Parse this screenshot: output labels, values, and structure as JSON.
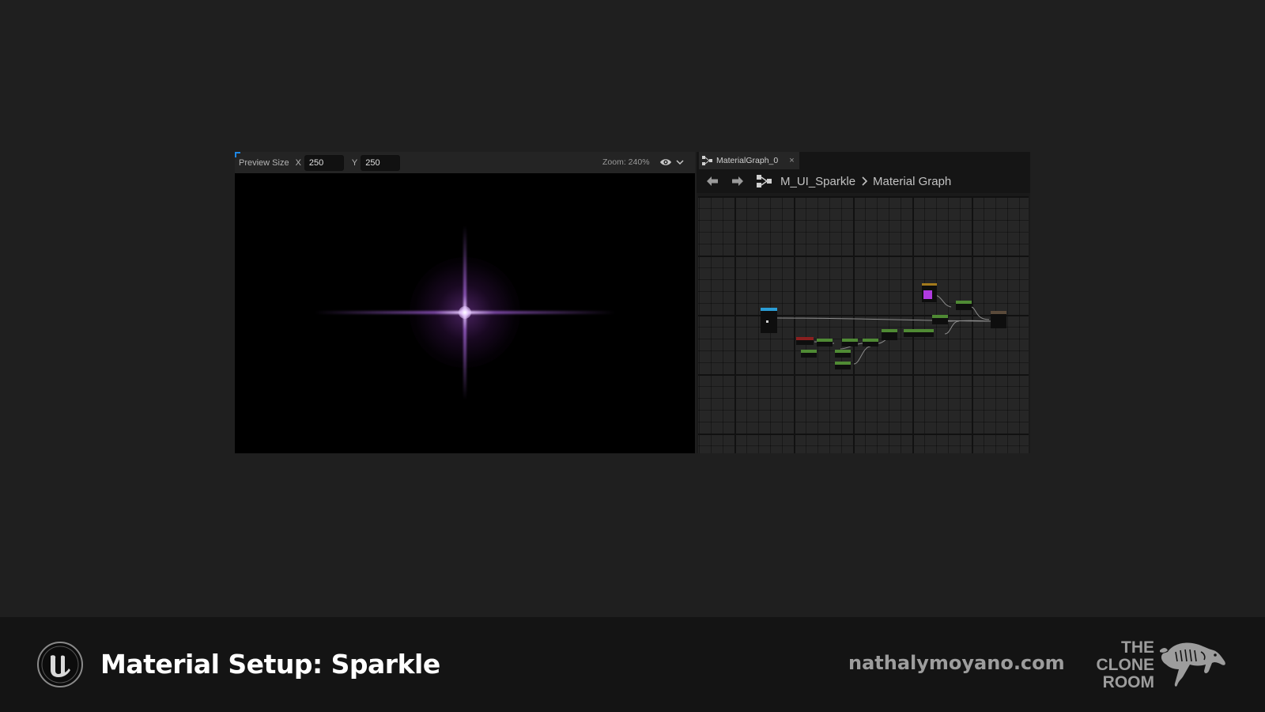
{
  "preview": {
    "size_label": "Preview Size",
    "x_label": "X",
    "x_value": "250",
    "y_label": "Y",
    "y_value": "250",
    "zoom_label": "Zoom: 240%",
    "view_menu_icon": "eye-icon",
    "glow_color": "#b070e0"
  },
  "graph": {
    "tab_title": "MaterialGraph_0",
    "tab_close": "×",
    "back_icon": "arrow-left-icon",
    "forward_icon": "arrow-right-icon",
    "breadcrumb_root": "M_UI_Sparkle",
    "breadcrumb_current": "Material Graph",
    "node_colors": {
      "math": "#4f8a34",
      "texcoord": "#8a1f1f",
      "constant": "#a37a1c",
      "parameter": "#2b9dd6",
      "vector": "#b03ae0",
      "output": "#5a4a3a"
    }
  },
  "footer": {
    "title": "Material Setup: Sparkle",
    "url": "nathalymoyano.com",
    "studio_line1": "THE",
    "studio_line2": "CLONE",
    "studio_line3": "ROOM",
    "engine_logo": "unreal-engine-logo",
    "studio_logo": "horse-logo"
  }
}
